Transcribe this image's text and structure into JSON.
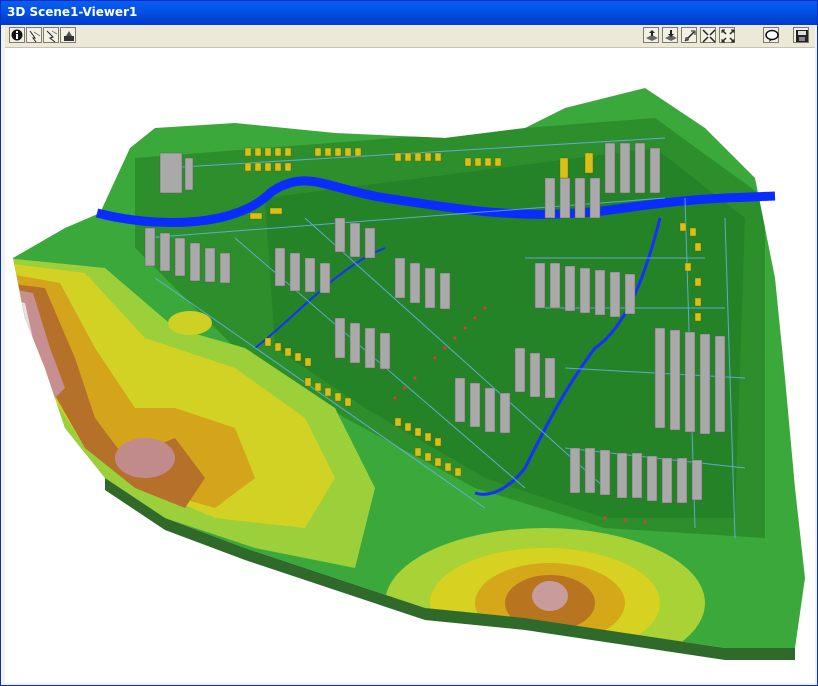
{
  "window": {
    "title": "3D Scene1-Viewer1"
  },
  "toolbar": {
    "left_buttons": [
      {
        "name": "identify-button",
        "icon": "info-icon"
      },
      {
        "name": "navigate-button",
        "icon": "navigate-icon"
      },
      {
        "name": "fly-button",
        "icon": "fly-icon"
      },
      {
        "name": "observer-button",
        "icon": "observer-icon"
      }
    ],
    "right_buttons": [
      {
        "name": "layer-up-button",
        "icon": "layer-up-icon"
      },
      {
        "name": "layer-down-button",
        "icon": "layer-down-icon"
      },
      {
        "name": "zoom-to-target-button",
        "icon": "zoom-target-icon"
      },
      {
        "name": "zoom-in-button",
        "icon": "zoom-in-arrows-icon"
      },
      {
        "name": "full-extent-button",
        "icon": "full-extent-icon"
      },
      {
        "name": "chat-button",
        "icon": "speech-bubble-icon"
      },
      {
        "name": "save-button",
        "icon": "floppy-disk-icon"
      }
    ]
  },
  "colors": {
    "title_bar": "#0055e5",
    "terrain_green_dark": "#1f8a2a",
    "terrain_green": "#3aa83a",
    "terrain_yellow": "#d8d020",
    "terrain_orange": "#c98a10",
    "terrain_brown": "#a35a2a",
    "terrain_pink": "#c89a9a",
    "river": "#0a2cff",
    "buildings": "#a8a8a8",
    "houses": "#d8c018"
  }
}
